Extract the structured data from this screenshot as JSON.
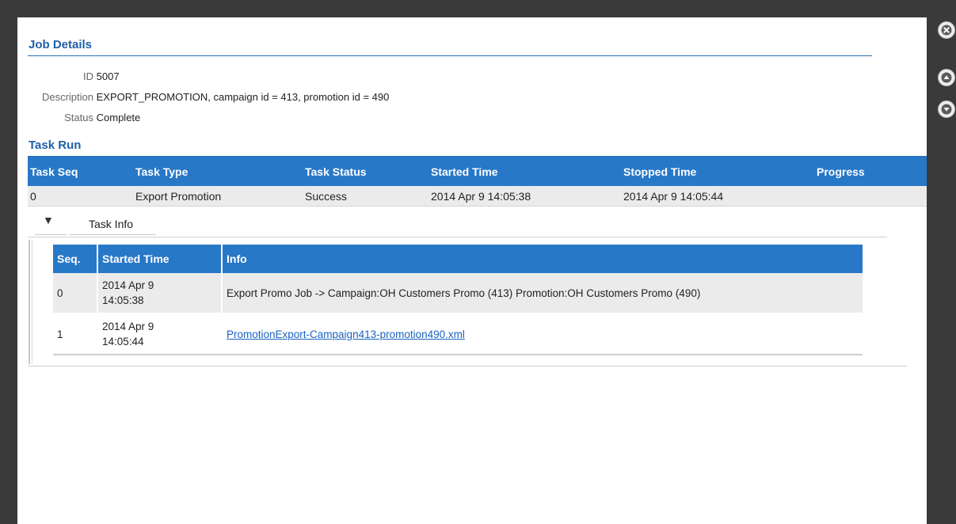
{
  "job_details": {
    "title": "Job Details",
    "id_label": "ID",
    "id_value": "5007",
    "description_label": "Description",
    "description_value": "EXPORT_PROMOTION, campaign id = 413, promotion id = 490",
    "status_label": "Status",
    "status_value": "Complete"
  },
  "task_run": {
    "title": "Task Run",
    "columns": [
      "Task Seq",
      "Task Type",
      "Task Status",
      "Started Time",
      "Stopped Time",
      "Progress"
    ],
    "rows": [
      {
        "seq": "0",
        "type": "Export Promotion",
        "status": "Success",
        "started": "2014 Apr 9 14:05:38",
        "stopped": "2014 Apr 9 14:05:44",
        "progress": ""
      }
    ]
  },
  "task_info": {
    "toggle_glyph": "▼",
    "tab_label": "Task Info",
    "columns": [
      "Seq.",
      "Started Time",
      "Info"
    ],
    "rows": [
      {
        "seq": "0",
        "date": "2014 Apr 9",
        "time": "14:05:38",
        "info": "Export Promo Job -> Campaign:OH Customers Promo (413) Promotion:OH Customers Promo (490)"
      },
      {
        "seq": "1",
        "date": "2014 Apr 9",
        "time": "14:05:44",
        "info": "PromotionExport-Campaign413-promotion490.xml"
      }
    ]
  },
  "side_controls": {
    "close_icon": "close-icon",
    "up_icon": "chevron-up-icon",
    "down_icon": "chevron-down-icon"
  },
  "colors": {
    "header_blue": "#2878c8",
    "title_blue": "#1f5fa8",
    "link_blue": "#1a63c0"
  }
}
